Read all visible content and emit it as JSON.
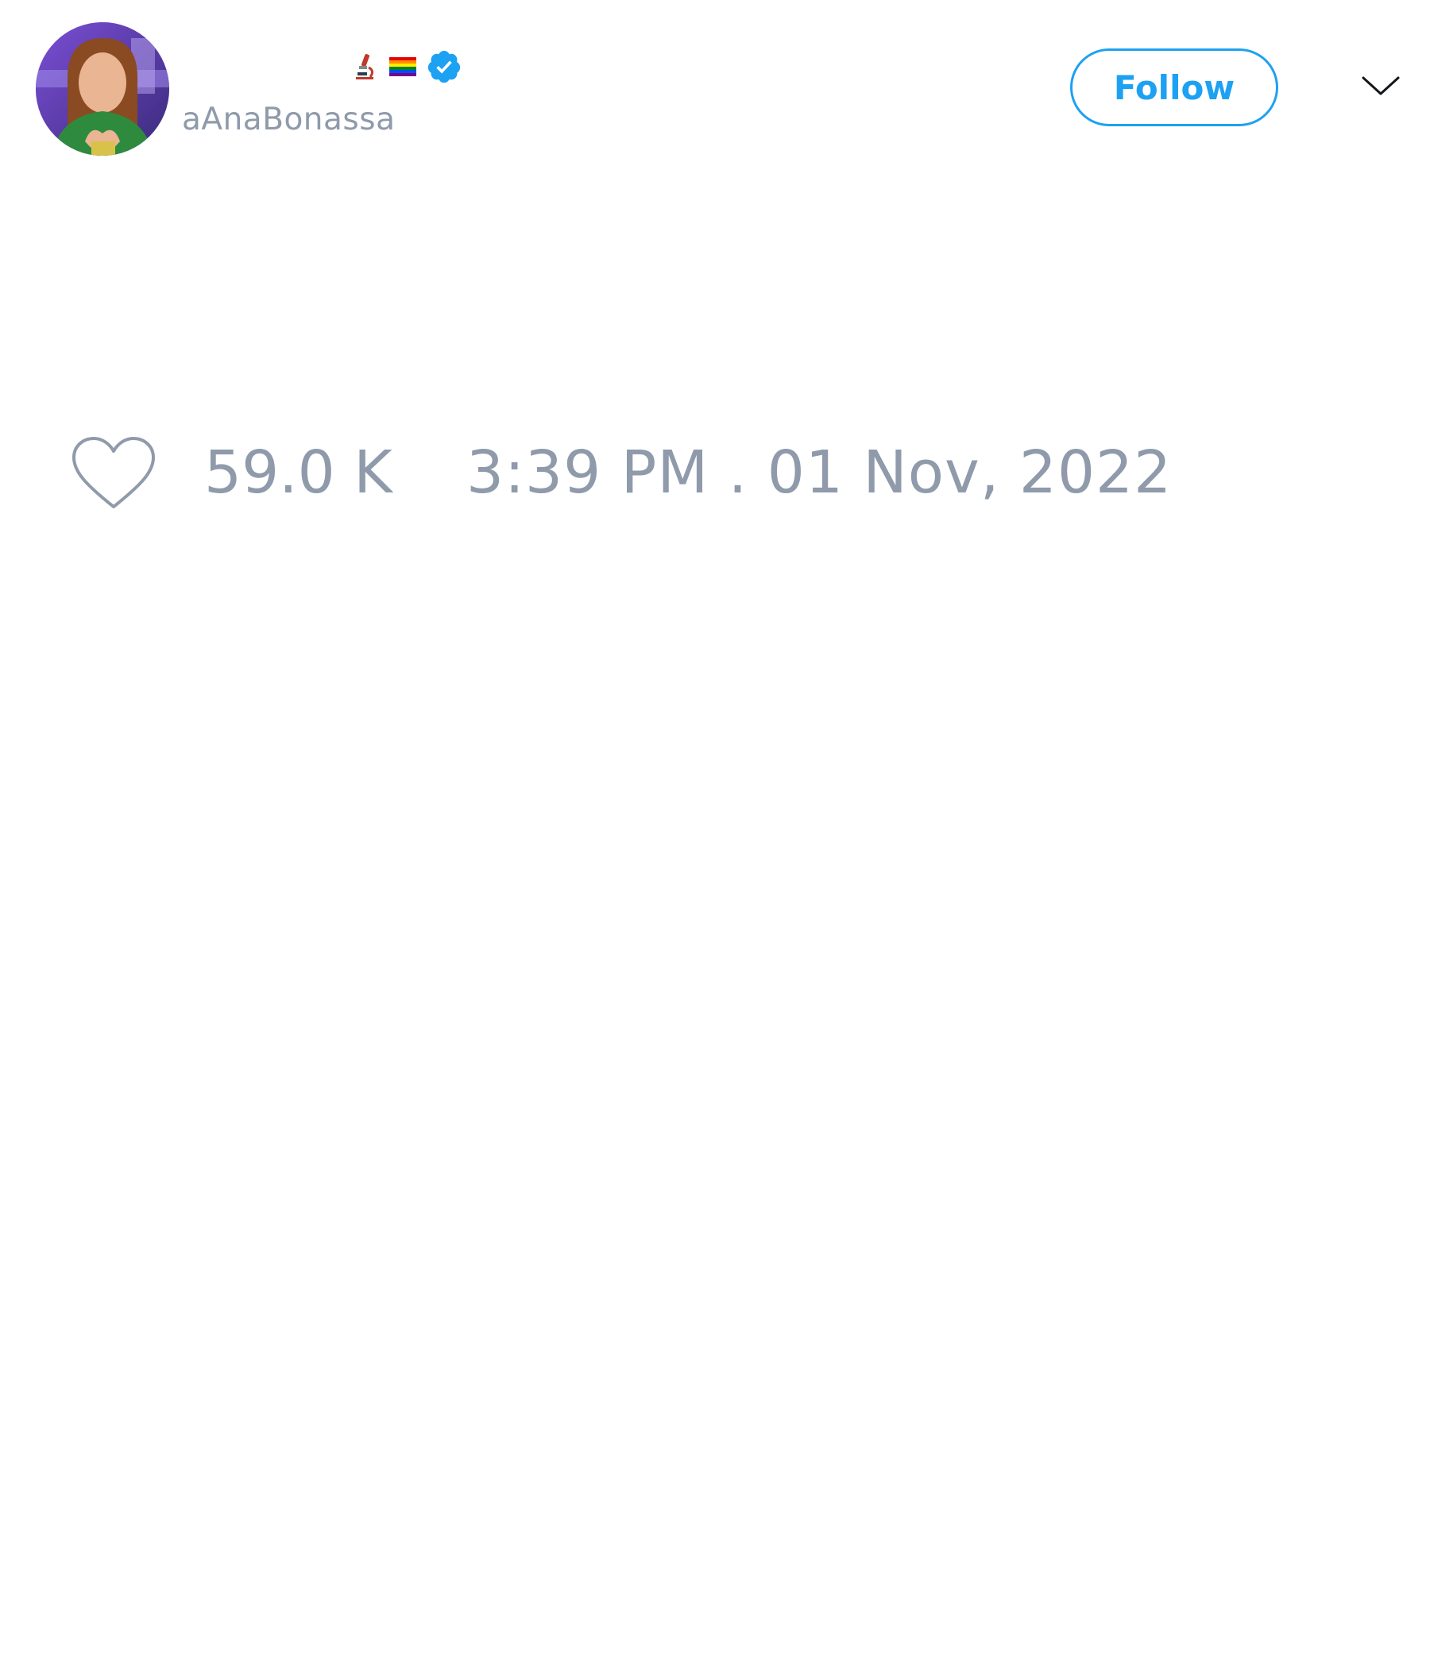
{
  "tweet": {
    "author": {
      "display_name": "",
      "handle": "aAnaBonassa",
      "avatar_icon": "avatar-photo",
      "badges": [
        "microscope-icon",
        "rainbow-flag-icon",
        "verified-icon"
      ]
    },
    "follow_label": "Follow",
    "menu_icon": "chevron-down-icon",
    "likes": "59.0 K",
    "timestamp": "3:39 PM . 01 Nov, 2022"
  },
  "colors": {
    "accent": "#1da1f2",
    "muted_text": "#8f9aab",
    "background": "#ffffff"
  }
}
